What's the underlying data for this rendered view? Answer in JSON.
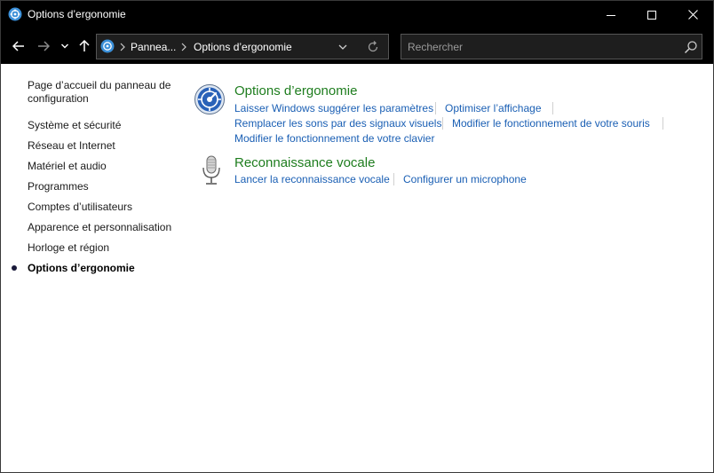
{
  "window": {
    "title": "Options d’ergonomie"
  },
  "nav": {
    "breadcrumb": [
      "Pannea...",
      "Options d’ergonomie"
    ],
    "search_placeholder": "Rechercher"
  },
  "sidebar": {
    "home_label": "Page d’accueil du panneau de configuration",
    "items": [
      {
        "label": "Système et sécurité",
        "active": false
      },
      {
        "label": "Réseau et Internet",
        "active": false
      },
      {
        "label": "Matériel et audio",
        "active": false
      },
      {
        "label": "Programmes",
        "active": false
      },
      {
        "label": "Comptes d’utilisateurs",
        "active": false
      },
      {
        "label": "Apparence et personnalisation",
        "active": false
      },
      {
        "label": "Horloge et région",
        "active": false
      },
      {
        "label": "Options d’ergonomie",
        "active": true
      }
    ]
  },
  "main": {
    "categories": [
      {
        "title": "Options d’ergonomie",
        "icon": "ease-of-access-icon",
        "links": [
          "Laisser Windows suggérer les paramètres",
          "Optimiser l’affichage",
          "Remplacer les sons par des signaux visuels",
          "Modifier le fonctionnement de votre souris",
          "Modifier le fonctionnement de votre clavier"
        ]
      },
      {
        "title": "Reconnaissance vocale",
        "icon": "microphone-icon",
        "links": [
          "Lancer la reconnaissance vocale",
          "Configurer un microphone"
        ]
      }
    ]
  },
  "colors": {
    "title_bar": "#000000",
    "category_title": "#1e7d1e",
    "link": "#1a5fb4"
  }
}
